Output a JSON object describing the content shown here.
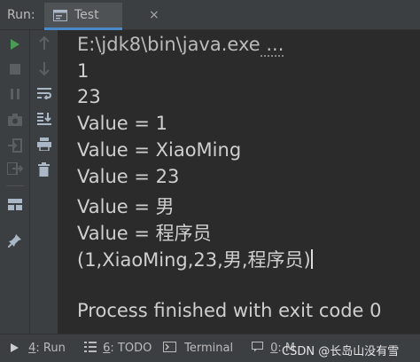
{
  "header": {
    "run_label": "Run:",
    "tab_title": "Test",
    "close_glyph": "×"
  },
  "console": {
    "command": "E:\\jdk8\\bin\\java.exe",
    "command_ellipsis": " ...",
    "lines": [
      "1",
      "23",
      "Value = 1",
      "Value = XiaoMing",
      "Value = 23",
      "Value = 男",
      "Value = 程序员",
      "(1,XiaoMing,23,男,程序员)"
    ],
    "exit_message": "Process finished with exit code 0"
  },
  "bottom_bar": {
    "run_tab": {
      "number": "4",
      "label": ": Run"
    },
    "todo_tab": {
      "number": "6",
      "label": ": TODO"
    },
    "terminal_tab": {
      "label": "Terminal"
    },
    "messages_tab": {
      "number": "0",
      "label": ": M"
    },
    "watermark": "CSDN @长岛山没有雪"
  },
  "colors": {
    "background": "#2b2b2b",
    "panel": "#3c3f41",
    "accent": "#4a88c7",
    "run_green": "#499c54"
  }
}
